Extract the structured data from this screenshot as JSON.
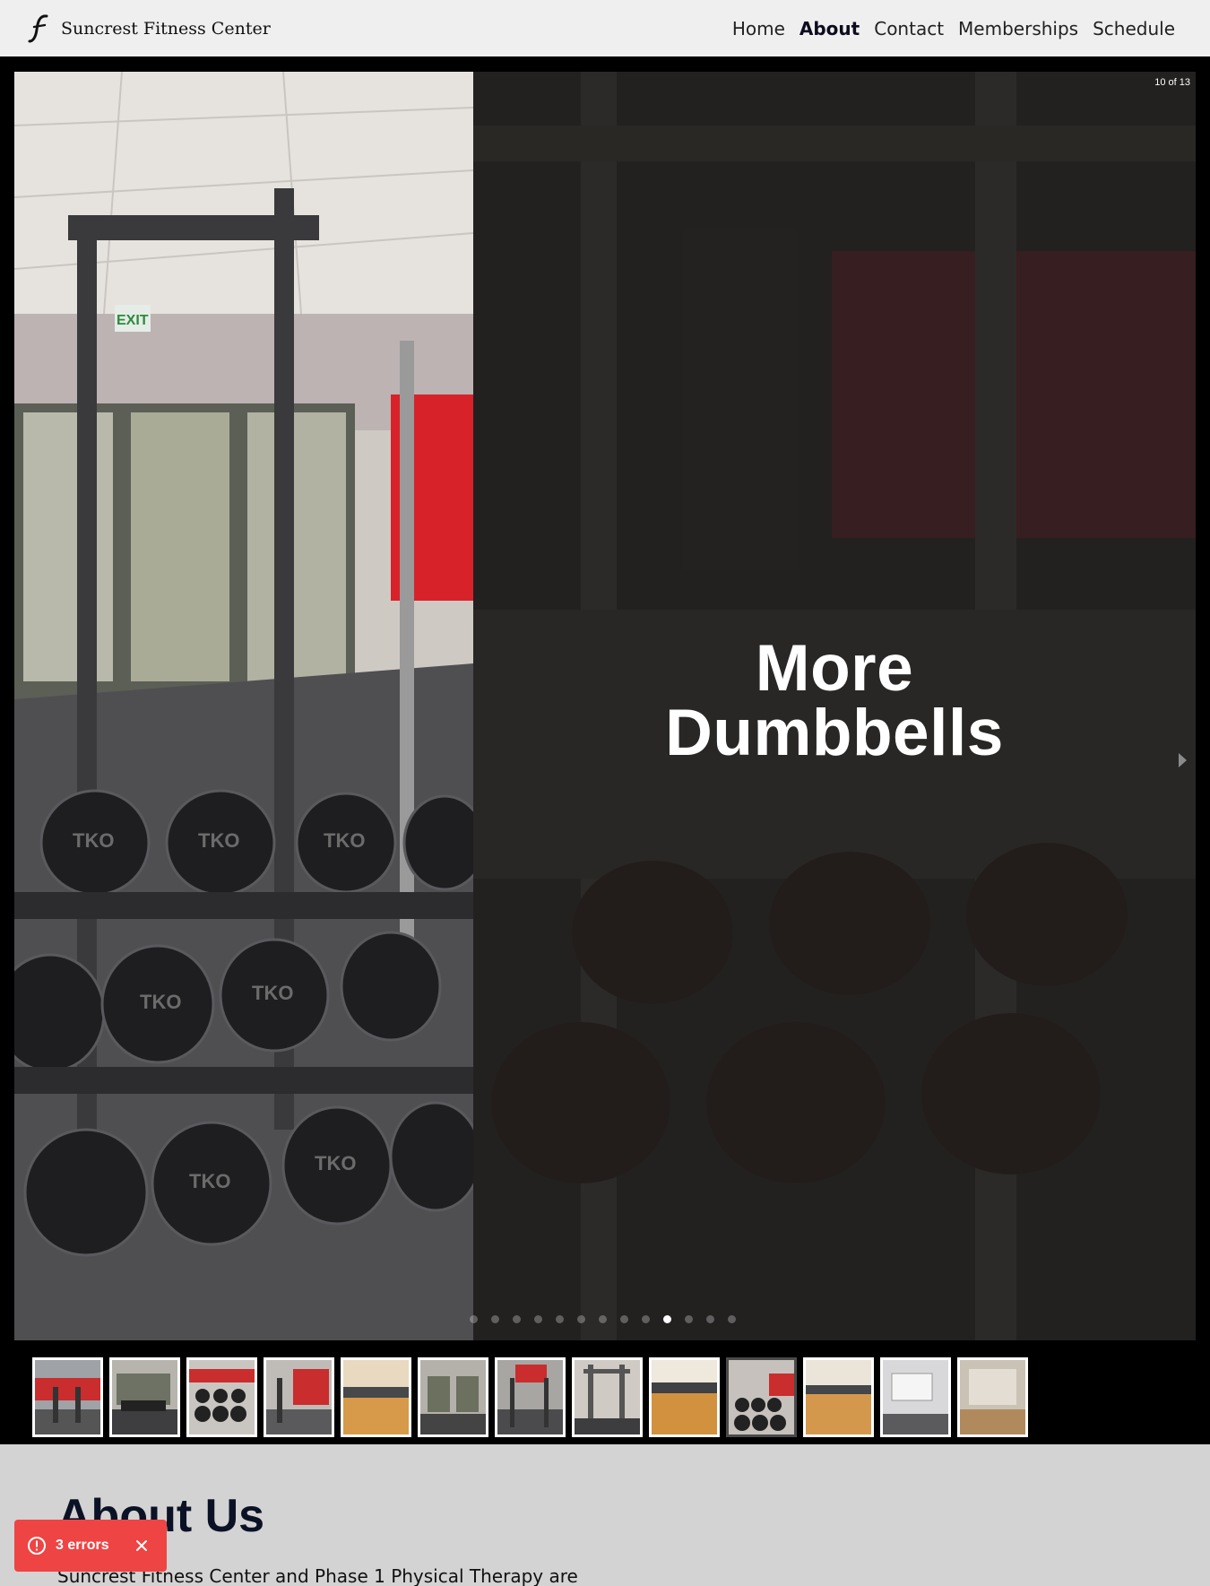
{
  "nav": {
    "brand": "Suncrest Fitness Center",
    "links": [
      {
        "label": "Home",
        "active": false
      },
      {
        "label": "About",
        "active": true
      },
      {
        "label": "Contact",
        "active": false
      },
      {
        "label": "Memberships",
        "active": false
      },
      {
        "label": "Schedule",
        "active": false
      }
    ]
  },
  "carousel": {
    "counter": "10 of 13",
    "title_line1": "More",
    "title_line2": "Dumbbells",
    "current": 10,
    "total": 13
  },
  "about": {
    "heading": "About Us",
    "text": "Suncrest Fitness Center and Phase 1 Physical Therapy are"
  },
  "toast": {
    "label": "3 errors"
  },
  "colors": {
    "accent": "#ef4444",
    "wall_red": "#d8222a",
    "floor": "#c98a3d"
  }
}
